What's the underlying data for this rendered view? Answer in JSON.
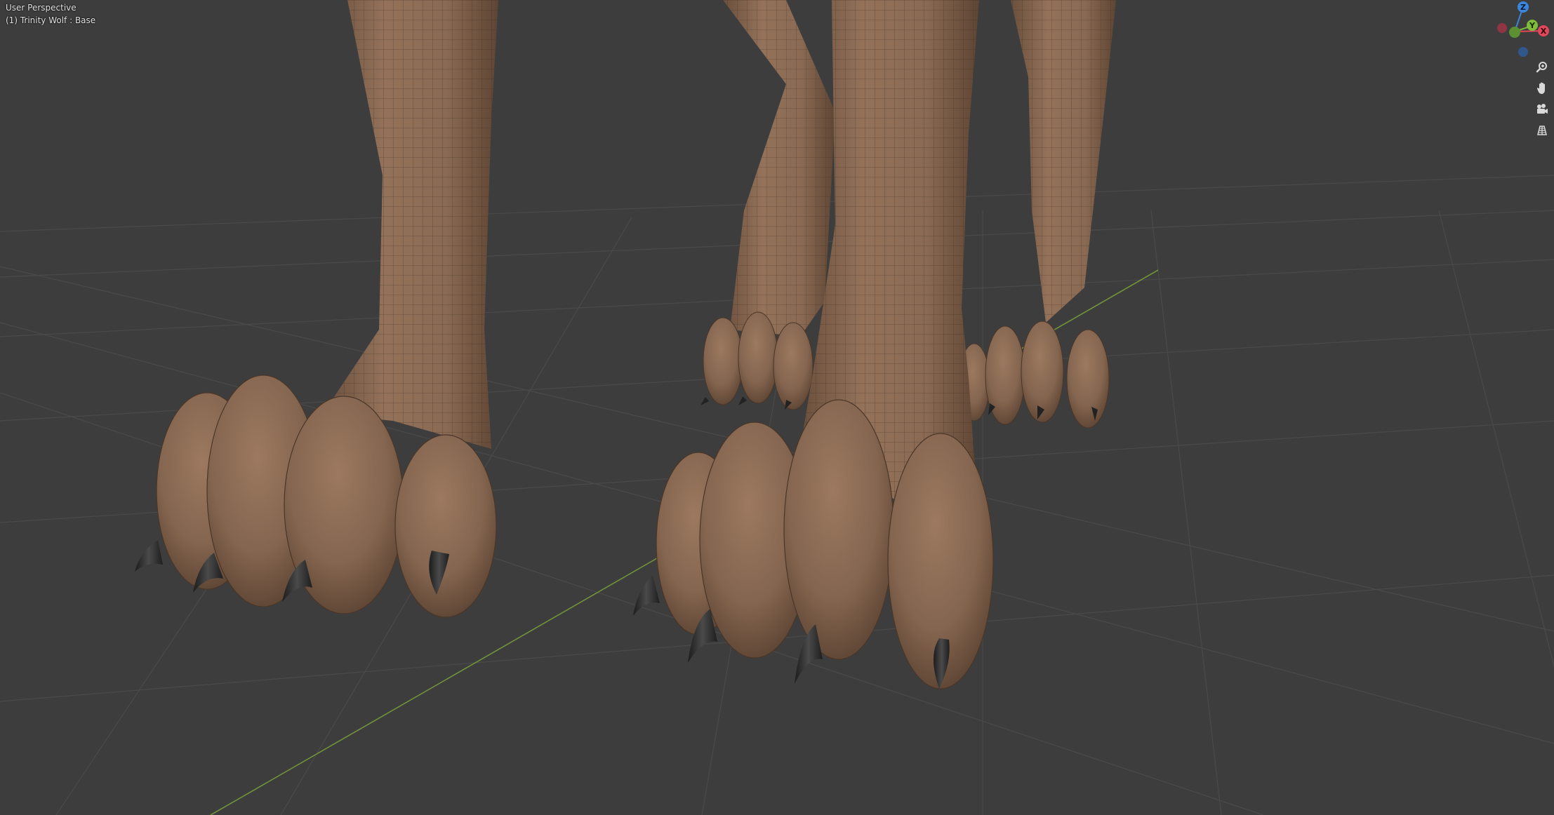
{
  "viewport": {
    "view_name": "User Perspective",
    "object_label": "(1) Trinity Wolf : Base"
  },
  "gizmo": {
    "z_label": "Z",
    "y_label": "Y",
    "x_label": "X",
    "colors": {
      "x": "#e2465a",
      "y": "#7fbb3c",
      "z": "#3a86db",
      "negative_y": "#5a7a3a",
      "negative_x": "#a03446",
      "negative_z": "#2e5d9b"
    }
  },
  "nav_tools": [
    {
      "name": "zoom-icon"
    },
    {
      "name": "pan-hand-icon"
    },
    {
      "name": "camera-icon"
    },
    {
      "name": "ortho-grid-icon"
    }
  ],
  "colors": {
    "background": "#3d3d3d",
    "grid_line": "#4b4b4b",
    "x_axis": "#7a9a3a",
    "skin": "#8a6a53",
    "skin_dark": "#5a4231",
    "claw": "#2a2a2a",
    "wire": "#2d221a"
  }
}
